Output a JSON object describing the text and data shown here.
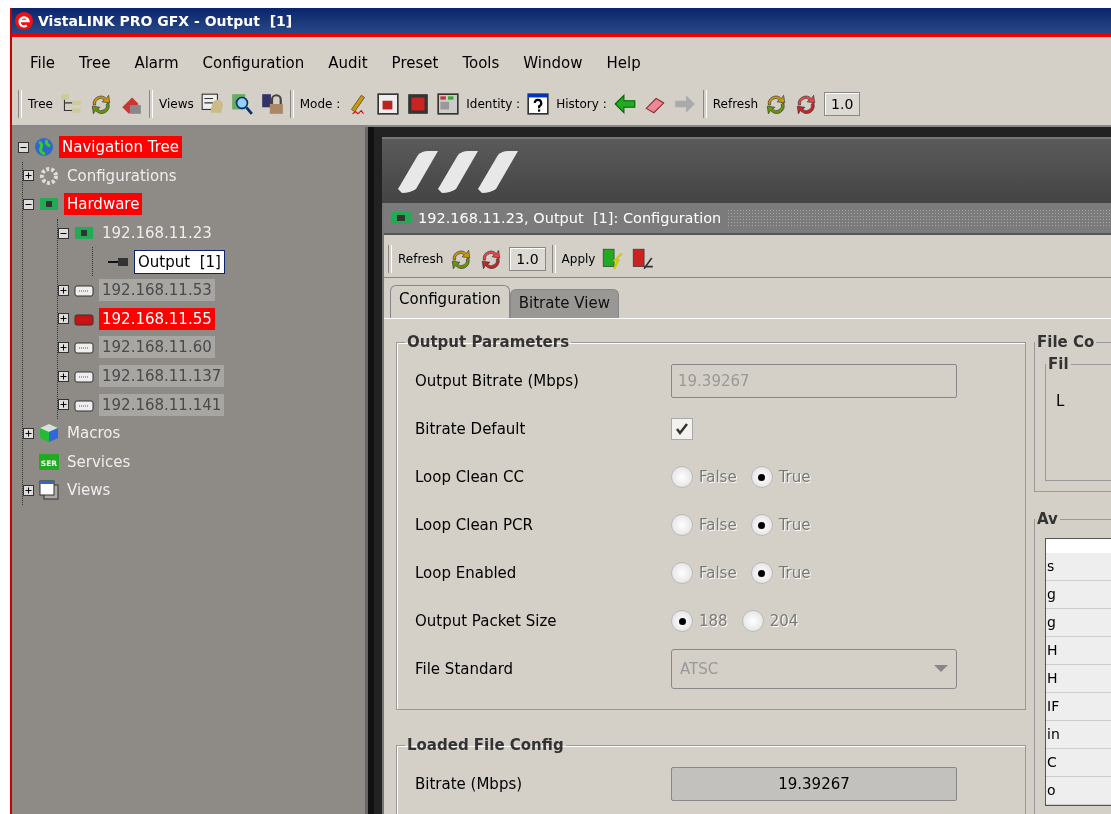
{
  "window": {
    "title": "VistaLINK PRO GFX - Output  [1]"
  },
  "menu": [
    {
      "label": "File"
    },
    {
      "label": "Tree"
    },
    {
      "label": "Alarm"
    },
    {
      "label": "Configuration"
    },
    {
      "label": "Audit"
    },
    {
      "label": "Preset"
    },
    {
      "label": "Tools"
    },
    {
      "label": "Window"
    },
    {
      "label": "Help"
    }
  ],
  "toolbar": [
    {
      "label": "Tree"
    },
    {
      "label": "Views"
    },
    {
      "label": "Mode :"
    },
    {
      "label": "Identity :"
    },
    {
      "label": "History :"
    },
    {
      "label": "Refresh",
      "value": "1.0"
    }
  ],
  "tree": {
    "label": "Navigation Tree",
    "alarm": true,
    "dimmed": false,
    "selected": false,
    "expanded": true,
    "children": [
      {
        "label": "Configurations",
        "alarm": false,
        "dimmed": false,
        "selected": false,
        "expanded": false
      },
      {
        "label": "Hardware",
        "alarm": true,
        "dimmed": false,
        "selected": false,
        "expanded": true,
        "children": [
          {
            "label": "192.168.11.23",
            "alarm": false,
            "dimmed": false,
            "selected": false,
            "expanded": true,
            "children": [
              {
                "label": "Output  [1]",
                "alarm": false,
                "dimmed": false,
                "selected": true
              }
            ]
          },
          {
            "label": "192.168.11.53",
            "alarm": false,
            "dimmed": true,
            "selected": false,
            "expanded": false
          },
          {
            "label": "192.168.11.55",
            "alarm": true,
            "dimmed": false,
            "selected": false,
            "expanded": false
          },
          {
            "label": "192.168.11.60",
            "alarm": false,
            "dimmed": true,
            "selected": false,
            "expanded": false
          },
          {
            "label": "192.168.11.137",
            "alarm": false,
            "dimmed": true,
            "selected": false,
            "expanded": false
          },
          {
            "label": "192.168.11.141",
            "alarm": false,
            "dimmed": true,
            "selected": false,
            "expanded": false
          }
        ]
      },
      {
        "label": "Macros",
        "alarm": false,
        "dimmed": false,
        "selected": false,
        "expanded": false
      },
      {
        "label": "Services",
        "icon_text": "SER",
        "alarm": false,
        "dimmed": false,
        "selected": false
      },
      {
        "label": "Views",
        "alarm": false,
        "dimmed": false,
        "selected": false,
        "expanded": false
      }
    ]
  },
  "panel": {
    "title": "192.168.11.23, Output  [1]: Configuration",
    "toolbar": {
      "refresh_label": "Refresh",
      "interval": "1.0",
      "apply_label": "Apply"
    },
    "tabs": [
      {
        "label": "Configuration",
        "selected": true
      },
      {
        "label": "Bitrate View",
        "selected": false
      }
    ],
    "output_parameters": {
      "title": "Output Parameters",
      "rows": [
        {
          "kind": "text",
          "label": "Output Bitrate (Mbps)",
          "value": "19.39267",
          "disabled": true
        },
        {
          "kind": "checkbox",
          "label": "Bitrate Default",
          "checked": true
        },
        {
          "kind": "radio",
          "label": "Loop Clean CC",
          "disabled": true,
          "options": [
            {
              "label": "False",
              "selected": false
            },
            {
              "label": "True",
              "selected": true
            }
          ]
        },
        {
          "kind": "radio",
          "label": "Loop Clean PCR",
          "disabled": true,
          "options": [
            {
              "label": "False",
              "selected": false
            },
            {
              "label": "True",
              "selected": true
            }
          ]
        },
        {
          "kind": "radio",
          "label": "Loop Enabled",
          "disabled": true,
          "options": [
            {
              "label": "False",
              "selected": false
            },
            {
              "label": "True",
              "selected": true
            }
          ]
        },
        {
          "kind": "radio",
          "label": "Output Packet Size",
          "disabled": true,
          "options": [
            {
              "label": "188",
              "selected": true
            },
            {
              "label": "204",
              "selected": false
            }
          ]
        },
        {
          "kind": "select",
          "label": "File Standard",
          "value": "ATSC",
          "disabled": true
        }
      ]
    },
    "loaded_file_config": {
      "title": "Loaded File Config",
      "rows": [
        {
          "kind": "readonly",
          "label": "Bitrate (Mbps)",
          "value": "19.39267"
        }
      ]
    },
    "file_config": {
      "title": "File Co",
      "inner_title": "Fil",
      "inner_text": "L",
      "list_title": "Av",
      "list_items": [
        "s",
        "g",
        "g",
        "H",
        "H",
        "IF",
        "in",
        "C",
        "o"
      ]
    }
  }
}
